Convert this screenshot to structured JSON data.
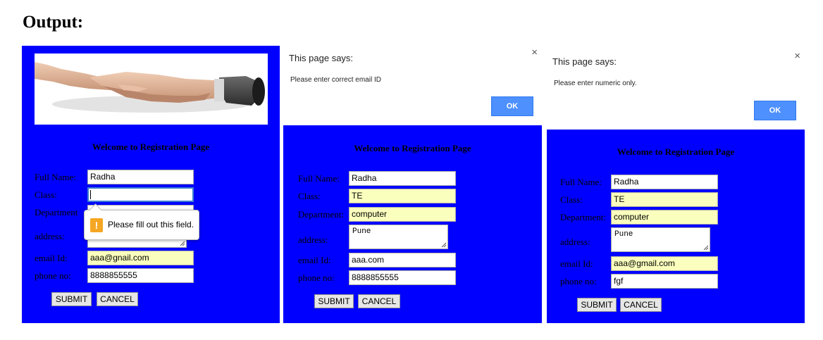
{
  "heading": "Output:",
  "panel_color": "#0000fe",
  "autofill_color": "#faffbd",
  "screen1": {
    "title": "Welcome to Registration Page",
    "labels": {
      "full_name": "Full Name:",
      "class": "Class:",
      "department": "Department",
      "address": "address:",
      "email": "email Id:",
      "phone": "phone no:"
    },
    "values": {
      "full_name": "Radha",
      "class": "",
      "department": "",
      "address": "",
      "email": "aaa@gnail.com",
      "phone": "8888855555"
    },
    "tooltip": "Please fill out this field.",
    "submit": "SUBMIT",
    "cancel": "CANCEL"
  },
  "screen2": {
    "dialog": {
      "title": "This page says:",
      "message": "Please enter correct email ID",
      "ok": "OK",
      "close": "×"
    },
    "title": "Welcome to Registration Page",
    "labels": {
      "full_name": "Full Name:",
      "class": "Class:",
      "department": "Department:",
      "address": "address:",
      "email": "email Id:",
      "phone": "phone no:"
    },
    "values": {
      "full_name": "Radha",
      "class": "TE",
      "department": "computer",
      "address": "Pune",
      "email": "aaa.com",
      "phone": "8888855555"
    },
    "submit": "SUBMIT",
    "cancel": "CANCEL"
  },
  "screen3": {
    "dialog": {
      "title": "This page says:",
      "message": "Please enter numeric only.",
      "ok": "OK",
      "close": "×"
    },
    "title": "Welcome to Registration Page",
    "labels": {
      "full_name": "Full Name:",
      "class": "Class:",
      "department": "Department:",
      "address": "address:",
      "email": "email Id:",
      "phone": "phone no:"
    },
    "values": {
      "full_name": "Radha",
      "class": "TE",
      "department": "computer",
      "address": "Pune",
      "email": "aaa@gmail.com",
      "phone": "fgf"
    },
    "submit": "SUBMIT",
    "cancel": "CANCEL"
  }
}
